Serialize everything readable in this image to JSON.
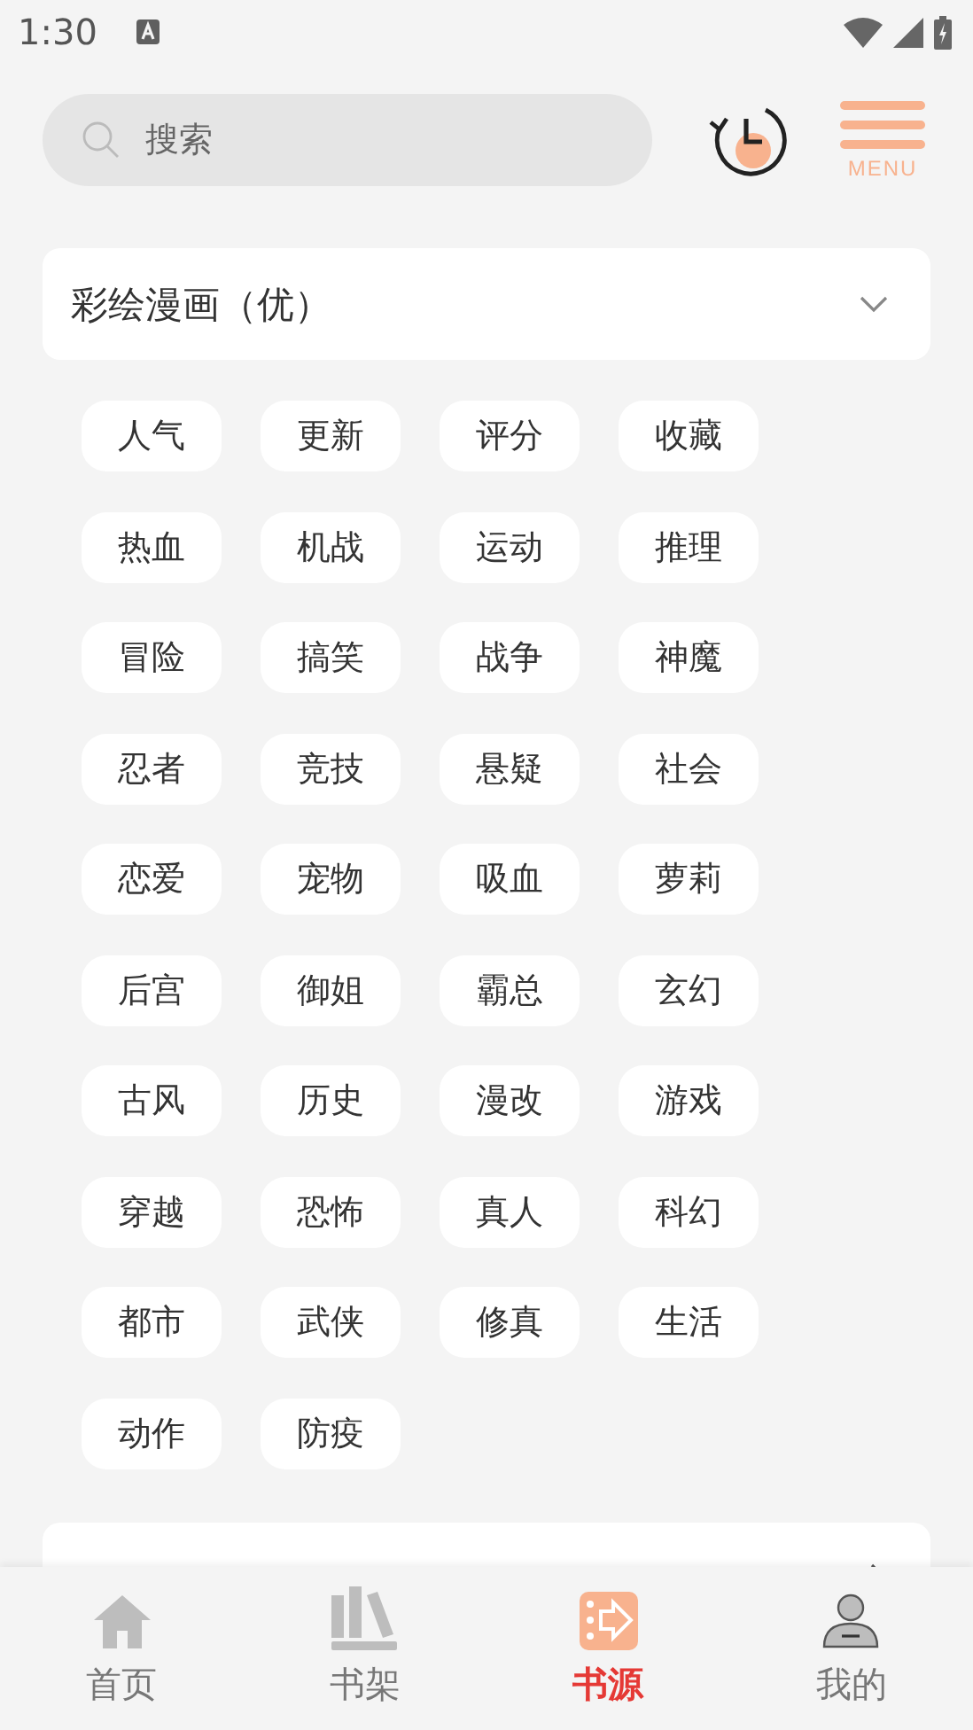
{
  "status_bar": {
    "time": "1:30"
  },
  "search": {
    "placeholder": "搜索"
  },
  "menu": {
    "label": "MENU"
  },
  "source": {
    "title": "彩绘漫画（优）",
    "expanded": true,
    "tags": [
      "人气",
      "更新",
      "评分",
      "收藏",
      "热血",
      "机战",
      "运动",
      "推理",
      "冒险",
      "搞笑",
      "战争",
      "神魔",
      "忍者",
      "竞技",
      "悬疑",
      "社会",
      "恋爱",
      "宠物",
      "吸血",
      "萝莉",
      "后宫",
      "御姐",
      "霸总",
      "玄幻",
      "古风",
      "历史",
      "漫改",
      "游戏",
      "穿越",
      "恐怖",
      "真人",
      "科幻",
      "都市",
      "武侠",
      "修真",
      "生活",
      "动作",
      "防疫"
    ]
  },
  "next_source": {
    "expanded": false
  },
  "tabs": [
    {
      "label": "首页",
      "kind": "home",
      "selected": false
    },
    {
      "label": "书架",
      "kind": "shelf",
      "selected": false
    },
    {
      "label": "书源",
      "kind": "source",
      "selected": true
    },
    {
      "label": "我的",
      "kind": "me",
      "selected": false
    }
  ]
}
